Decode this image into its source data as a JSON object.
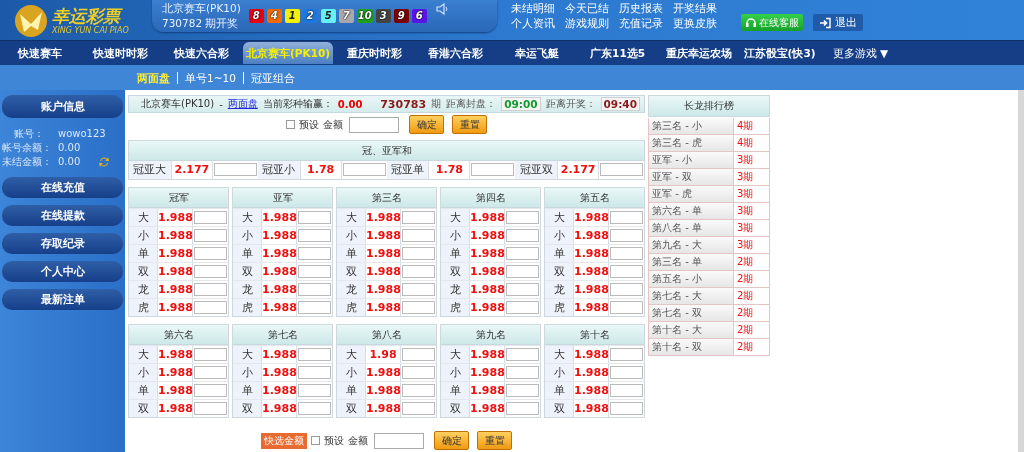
{
  "header": {
    "logo": {
      "title": "幸运彩票",
      "subtitle": "XING YUN CAI PIAO"
    },
    "draw": {
      "game": "北京赛车(PK10)",
      "issue": "730782 期开奖",
      "balls": [
        {
          "number": "8",
          "color": "#e60012"
        },
        {
          "number": "4",
          "color": "#f06a00"
        },
        {
          "number": "1",
          "color": "#f5f000"
        },
        {
          "number": "2",
          "color": "#1a78e0"
        },
        {
          "number": "5",
          "color": "#66f0f5"
        },
        {
          "number": "7",
          "color": "#a8a8a8"
        },
        {
          "number": "10",
          "color": "#1fa01f"
        },
        {
          "number": "3",
          "color": "#444444"
        },
        {
          "number": "9",
          "color": "#7a0000"
        },
        {
          "number": "6",
          "color": "#5a14e6"
        }
      ]
    },
    "links": [
      "未结明细",
      "今天已结",
      "历史报表",
      "开奖结果",
      "个人资讯",
      "游戏规则",
      "充值记录",
      "更换皮肤"
    ],
    "service_button": "在线客服",
    "logout_button": "退出"
  },
  "nav": {
    "items": [
      {
        "label": "快速赛车",
        "selected": false
      },
      {
        "label": "快速时时彩",
        "selected": false
      },
      {
        "label": "快速六合彩",
        "selected": false
      },
      {
        "label": "北京赛车(PK10)",
        "selected": true
      },
      {
        "label": "重庆时时彩",
        "selected": false
      },
      {
        "label": "香港六合彩",
        "selected": false
      },
      {
        "label": "幸运飞艇",
        "selected": false
      },
      {
        "label": "广东11选5",
        "selected": false
      },
      {
        "label": "重庆幸运农场",
        "selected": false
      },
      {
        "label": "江苏骰宝(快3)",
        "selected": false
      }
    ],
    "more": {
      "label": "更多游戏",
      "caret": "▼"
    }
  },
  "subnav": [
    {
      "label": "两面盘",
      "selected": true
    },
    {
      "label": "单号1~10",
      "selected": false
    },
    {
      "label": "冠亚组合",
      "selected": false
    }
  ],
  "sidebar": {
    "title": "账户信息",
    "fields": [
      {
        "label": "账号：",
        "value": "wowo123"
      },
      {
        "label": "帐号余额：",
        "value": "0.00"
      },
      {
        "label": "未结金额：",
        "value": "0.00"
      }
    ],
    "buttons": [
      "在线充值",
      "在线提款",
      "存取纪录",
      "个人中心",
      "最新注单"
    ]
  },
  "info_bar": {
    "game": "北京赛车(PK10)",
    "dash": "-",
    "mode": "两面盘",
    "winloss_label": "当前彩种输赢：",
    "winloss": "0.00",
    "issue": "730783",
    "issue_unit": "期",
    "close_label": "距离封盘：",
    "close_time": "09:00",
    "draw_label": "距离开奖：",
    "draw_time": "09:40"
  },
  "preset_bar": {
    "checked": false,
    "preset_label": "预设",
    "amount_label": "金额",
    "confirm": "确定",
    "reset": "重置"
  },
  "sum_table": {
    "title": "冠、亚军和",
    "cells": [
      {
        "label": "冠亚大",
        "odds": "2.177"
      },
      {
        "label": "冠亚小",
        "odds": "1.78"
      },
      {
        "label": "冠亚单",
        "odds": "1.78"
      },
      {
        "label": "冠亚双",
        "odds": "2.177"
      }
    ]
  },
  "positions": [
    {
      "title": "冠军",
      "rows": [
        {
          "label": "大",
          "odds": "1.988"
        },
        {
          "label": "小",
          "odds": "1.988"
        },
        {
          "label": "单",
          "odds": "1.988"
        },
        {
          "label": "双",
          "odds": "1.988"
        },
        {
          "label": "龙",
          "odds": "1.988"
        },
        {
          "label": "虎",
          "odds": "1.988"
        }
      ]
    },
    {
      "title": "亚军",
      "rows": [
        {
          "label": "大",
          "odds": "1.988"
        },
        {
          "label": "小",
          "odds": "1.988"
        },
        {
          "label": "单",
          "odds": "1.988"
        },
        {
          "label": "双",
          "odds": "1.988"
        },
        {
          "label": "龙",
          "odds": "1.988"
        },
        {
          "label": "虎",
          "odds": "1.988"
        }
      ]
    },
    {
      "title": "第三名",
      "rows": [
        {
          "label": "大",
          "odds": "1.988"
        },
        {
          "label": "小",
          "odds": "1.988"
        },
        {
          "label": "单",
          "odds": "1.988"
        },
        {
          "label": "双",
          "odds": "1.988"
        },
        {
          "label": "龙",
          "odds": "1.988"
        },
        {
          "label": "虎",
          "odds": "1.988"
        }
      ]
    },
    {
      "title": "第四名",
      "rows": [
        {
          "label": "大",
          "odds": "1.988"
        },
        {
          "label": "小",
          "odds": "1.988"
        },
        {
          "label": "单",
          "odds": "1.988"
        },
        {
          "label": "双",
          "odds": "1.988"
        },
        {
          "label": "龙",
          "odds": "1.988"
        },
        {
          "label": "虎",
          "odds": "1.988"
        }
      ]
    },
    {
      "title": "第五名",
      "rows": [
        {
          "label": "大",
          "odds": "1.988"
        },
        {
          "label": "小",
          "odds": "1.988"
        },
        {
          "label": "单",
          "odds": "1.988"
        },
        {
          "label": "双",
          "odds": "1.988"
        },
        {
          "label": "龙",
          "odds": "1.988"
        },
        {
          "label": "虎",
          "odds": "1.988"
        }
      ]
    },
    {
      "title": "第六名",
      "rows": [
        {
          "label": "大",
          "odds": "1.988"
        },
        {
          "label": "小",
          "odds": "1.988"
        },
        {
          "label": "单",
          "odds": "1.988"
        },
        {
          "label": "双",
          "odds": "1.988"
        }
      ]
    },
    {
      "title": "第七名",
      "rows": [
        {
          "label": "大",
          "odds": "1.988"
        },
        {
          "label": "小",
          "odds": "1.988"
        },
        {
          "label": "单",
          "odds": "1.988"
        },
        {
          "label": "双",
          "odds": "1.988"
        }
      ]
    },
    {
      "title": "第八名",
      "rows": [
        {
          "label": "大",
          "odds": "1.98"
        },
        {
          "label": "小",
          "odds": "1.988"
        },
        {
          "label": "单",
          "odds": "1.988"
        },
        {
          "label": "双",
          "odds": "1.988"
        }
      ]
    },
    {
      "title": "第九名",
      "rows": [
        {
          "label": "大",
          "odds": "1.988"
        },
        {
          "label": "小",
          "odds": "1.988"
        },
        {
          "label": "单",
          "odds": "1.988"
        },
        {
          "label": "双",
          "odds": "1.988"
        }
      ]
    },
    {
      "title": "第十名",
      "rows": [
        {
          "label": "大",
          "odds": "1.988"
        },
        {
          "label": "小",
          "odds": "1.988"
        },
        {
          "label": "单",
          "odds": "1.988"
        },
        {
          "label": "双",
          "odds": "1.988"
        }
      ]
    }
  ],
  "dragon": {
    "title": "长龙排行榜",
    "rows": [
      {
        "name": "第三名 - 小",
        "periods": "4期"
      },
      {
        "name": "第三名 - 虎",
        "periods": "4期"
      },
      {
        "name": "亚军 - 小",
        "periods": "3期"
      },
      {
        "name": "亚军 - 双",
        "periods": "3期"
      },
      {
        "name": "亚军 - 虎",
        "periods": "3期"
      },
      {
        "name": "第六名 - 单",
        "periods": "3期"
      },
      {
        "name": "第八名 - 单",
        "periods": "3期"
      },
      {
        "name": "第九名 - 大",
        "periods": "3期"
      },
      {
        "name": "第三名 - 单",
        "periods": "2期"
      },
      {
        "name": "第五名 - 小",
        "periods": "2期"
      },
      {
        "name": "第七名 - 大",
        "periods": "2期"
      },
      {
        "name": "第七名 - 双",
        "periods": "2期"
      },
      {
        "name": "第十名 - 大",
        "periods": "2期"
      },
      {
        "name": "第十名 - 双",
        "periods": "2期"
      }
    ]
  },
  "bottom_bar": {
    "quick_button": "快选金额",
    "checked": false,
    "preset_label": "预设",
    "amount_label": "金额",
    "confirm": "确定",
    "reset": "重置"
  }
}
